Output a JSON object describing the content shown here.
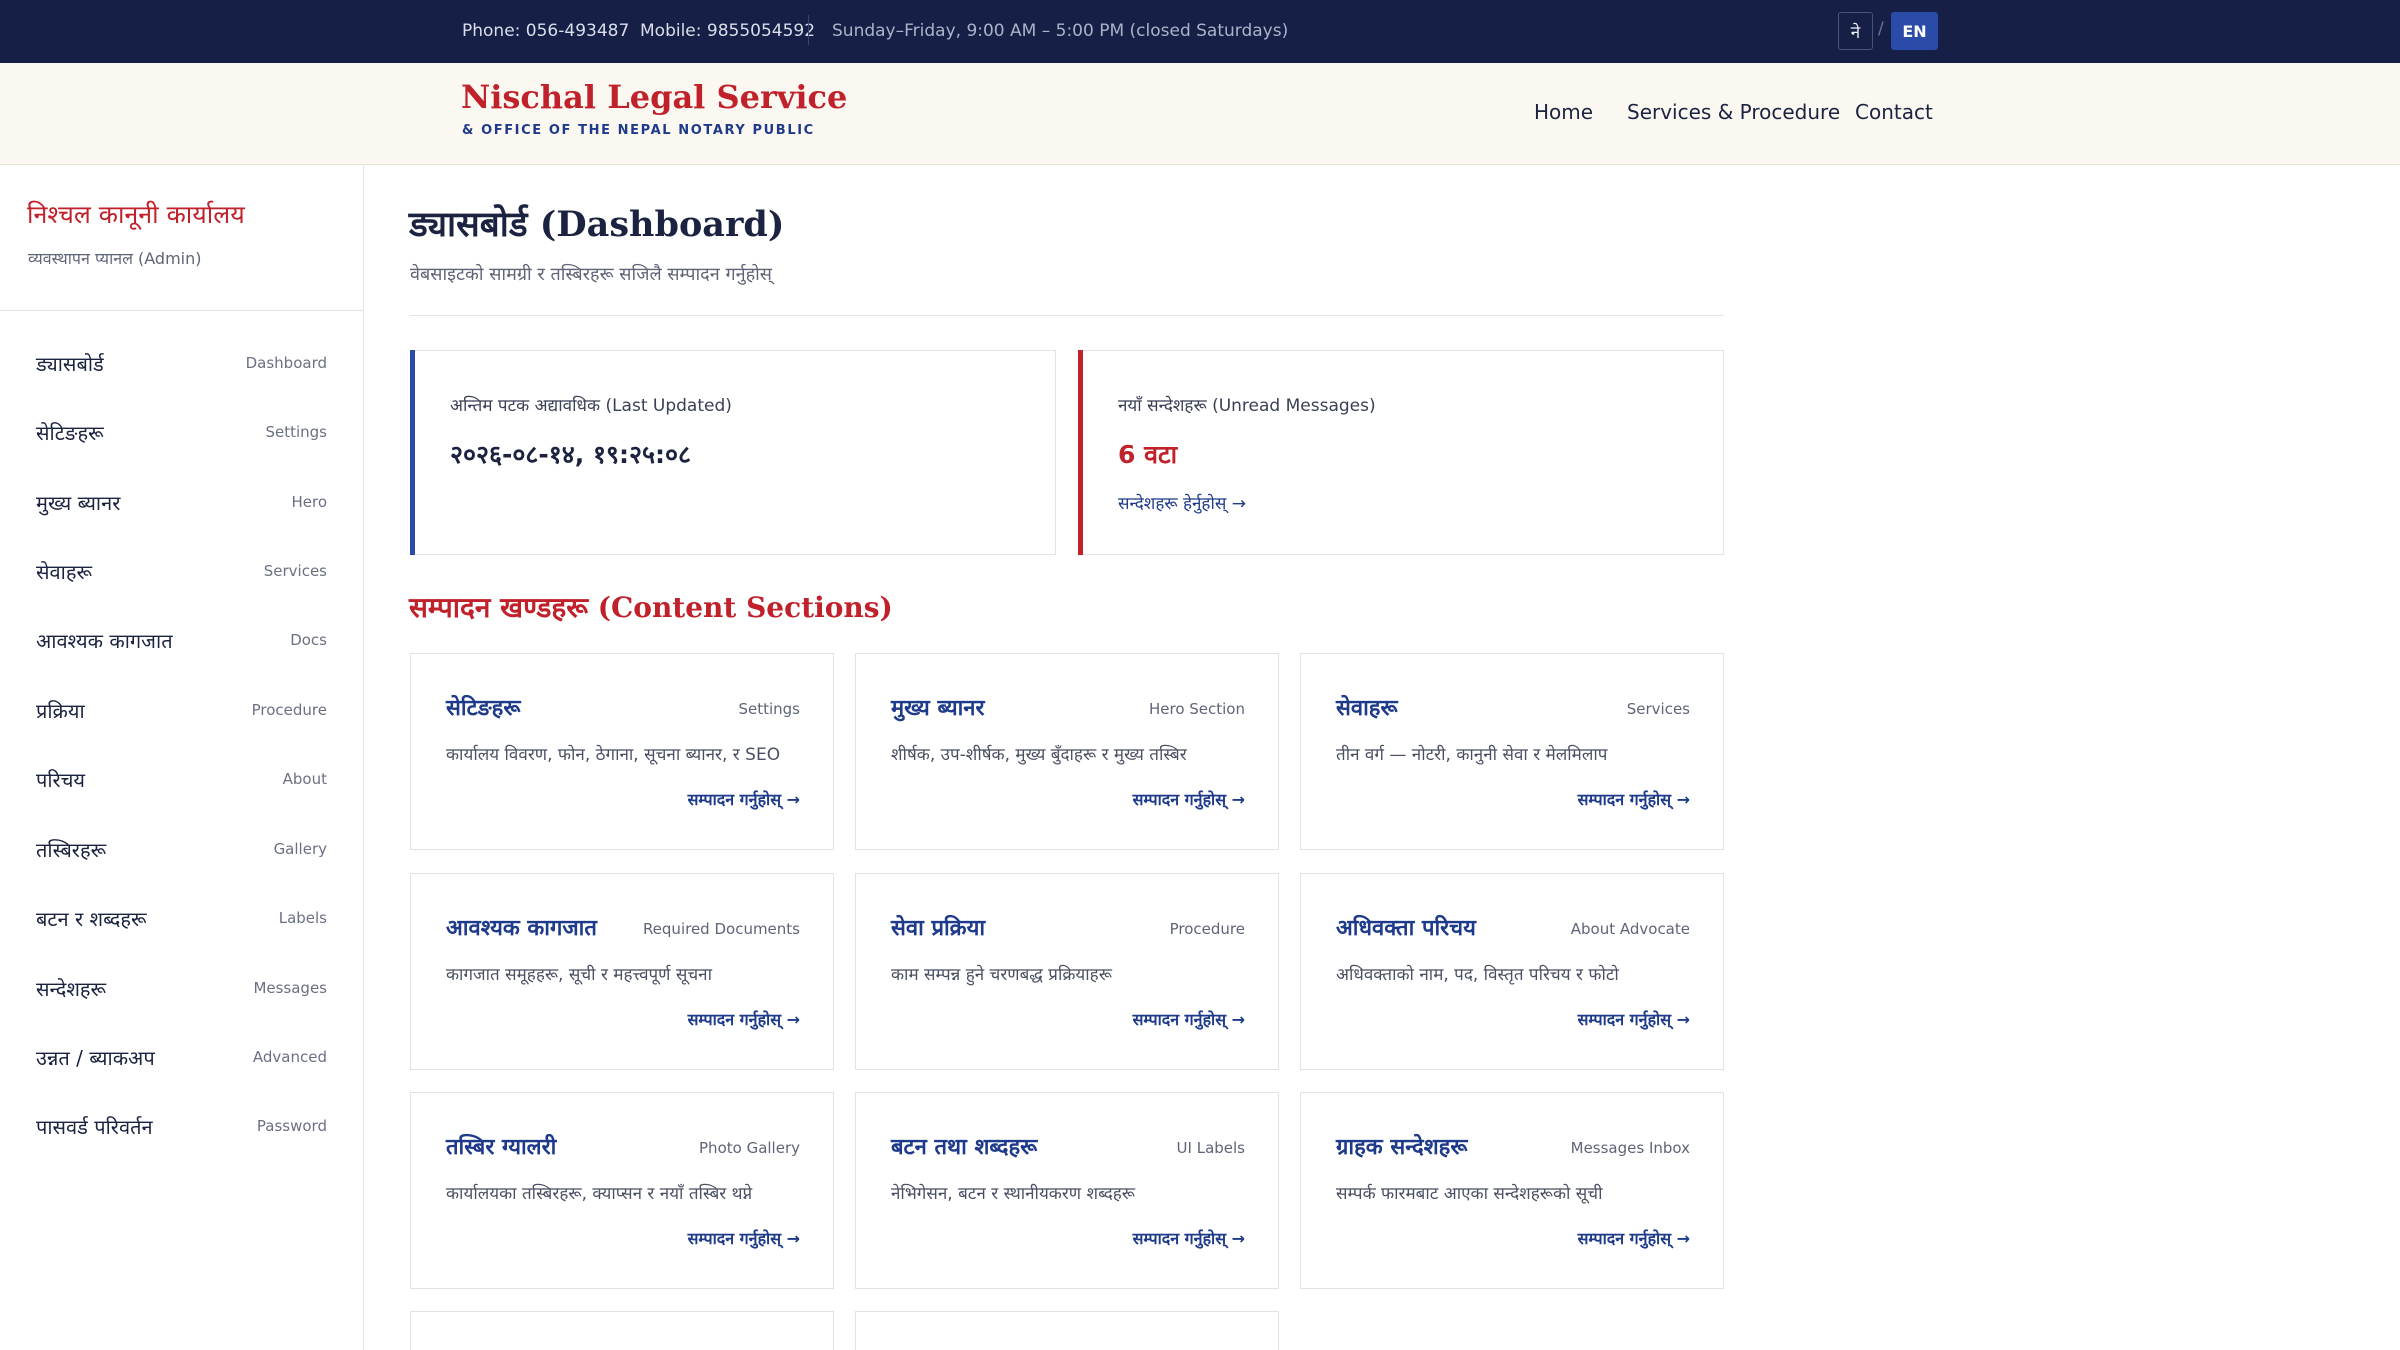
{
  "topbar": {
    "phone": "Phone: 056-493487",
    "mobile": "Mobile: 9855054592",
    "hours": "Sunday–Friday, 9:00 AM – 5:00 PM (closed Saturdays)",
    "lang_ne": "ने",
    "lang_slash": "/",
    "lang_en": "EN"
  },
  "header": {
    "brand_title": "Nischal Legal Service",
    "brand_sub": "& OFFICE OF THE NEPAL NOTARY PUBLIC",
    "nav": [
      "Home",
      "Services & Procedure",
      "Contact"
    ]
  },
  "sidebar": {
    "title": "निश्चल कानूनी कार्यालय",
    "subtitle": "व्यवस्थापन प्यानल (Admin)",
    "items": [
      {
        "ne": "ड्यासबोर्ड",
        "en": "Dashboard"
      },
      {
        "ne": "सेटिङहरू",
        "en": "Settings"
      },
      {
        "ne": "मुख्य ब्यानर",
        "en": "Hero"
      },
      {
        "ne": "सेवाहरू",
        "en": "Services"
      },
      {
        "ne": "आवश्यक कागजात",
        "en": "Docs"
      },
      {
        "ne": "प्रक्रिया",
        "en": "Procedure"
      },
      {
        "ne": "परिचय",
        "en": "About"
      },
      {
        "ne": "तस्बिरहरू",
        "en": "Gallery"
      },
      {
        "ne": "बटन र शब्दहरू",
        "en": "Labels"
      },
      {
        "ne": "सन्देशहरू",
        "en": "Messages"
      },
      {
        "ne": "उन्नत / ब्याकअप",
        "en": "Advanced"
      },
      {
        "ne": "पासवर्ड परिवर्तन",
        "en": "Password"
      }
    ]
  },
  "main": {
    "title": "ड्यासबोर्ड (Dashboard)",
    "subtitle": "वेबसाइटको सामग्री र तस्बिरहरू सजिलै सम्पादन गर्नुहोस्",
    "stats": {
      "last_updated_label": "अन्तिम पटक अद्यावधिक (Last Updated)",
      "last_updated_value": "२०२६-०८-१४, १९:२५:०८",
      "unread_label": "नयाँ सन्देशहरू (Unread Messages)",
      "unread_value": "6 वटा",
      "unread_link": "सन्देशहरू हेर्नुहोस् →"
    },
    "section_title": "सम्पादन खण्डहरू (Content Sections)",
    "edit_label": "सम्पादन गर्नुहोस् →",
    "cards": [
      {
        "title": "सेटिङहरू",
        "en": "Settings",
        "desc": "कार्यालय विवरण, फोन, ठेगाना, सूचना ब्यानर, र SEO"
      },
      {
        "title": "मुख्य ब्यानर",
        "en": "Hero Section",
        "desc": "शीर्षक, उप-शीर्षक, मुख्य बुँदाहरू र मुख्य तस्बिर"
      },
      {
        "title": "सेवाहरू",
        "en": "Services",
        "desc": "तीन वर्ग — नोटरी, कानुनी सेवा र मेलमिलाप"
      },
      {
        "title": "आवश्यक कागजात",
        "en": "Required Documents",
        "desc": "कागजात समूहहरू, सूची र महत्त्वपूर्ण सूचना"
      },
      {
        "title": "सेवा प्रक्रिया",
        "en": "Procedure",
        "desc": "काम सम्पन्न हुने चरणबद्ध प्रक्रियाहरू"
      },
      {
        "title": "अधिवक्ता परिचय",
        "en": "About Advocate",
        "desc": "अधिवक्ताको नाम, पद, विस्तृत परिचय र फोटो"
      },
      {
        "title": "तस्बिर ग्यालरी",
        "en": "Photo Gallery",
        "desc": "कार्यालयका तस्बिरहरू, क्याप्सन र नयाँ तस्बिर थप्ने"
      },
      {
        "title": "बटन तथा शब्दहरू",
        "en": "UI Labels",
        "desc": "नेभिगेसन, बटन र स्थानीयकरण शब्दहरू"
      },
      {
        "title": "ग्राहक सन्देशहरू",
        "en": "Messages Inbox",
        "desc": "सम्पर्क फारमबाट आएका सन्देशहरूको सूची"
      }
    ]
  },
  "colors": {
    "navy": "#161f45",
    "brand_red": "#c0212a",
    "link_blue": "#1e3a8a",
    "accent_blue": "#2a4ba8",
    "cream": "#faf8f1"
  }
}
